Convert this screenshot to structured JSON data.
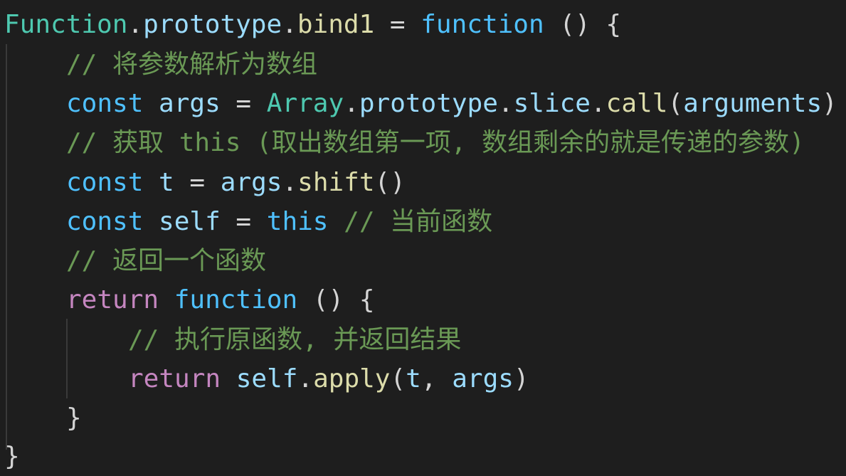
{
  "code": {
    "line1": {
      "obj": "Function",
      "dot1": ".",
      "prop1": "prototype",
      "dot2": ".",
      "prop2": "bind1",
      "eq": " = ",
      "kw": "function",
      "rest": " () {"
    },
    "line2": {
      "comment": "// 将参数解析为数组"
    },
    "line3": {
      "kw": "const",
      "name": " args",
      "eq": " = ",
      "cls": "Array",
      "dot1": ".",
      "prop1": "prototype",
      "dot2": ".",
      "prop2": "slice",
      "dot3": ".",
      "fn": "call",
      "open": "(",
      "arg": "arguments",
      "close": ")"
    },
    "line4": {
      "comment": "// 获取 this (取出数组第一项, 数组剩余的就是传递的参数)"
    },
    "line5": {
      "kw": "const",
      "name": " t",
      "eq": " = ",
      "obj": "args",
      "dot": ".",
      "fn": "shift",
      "parens": "()"
    },
    "line6": {
      "kw": "const",
      "name": " self",
      "eq": " = ",
      "this": "this",
      "comment": " // 当前函数"
    },
    "line7": {
      "comment": "// 返回一个函数"
    },
    "line8": {
      "ret": "return",
      "kw": " function",
      "rest": " () {"
    },
    "line9": {
      "comment": "// 执行原函数, 并返回结果"
    },
    "line10": {
      "ret": "return",
      "obj": " self",
      "dot": ".",
      "fn": "apply",
      "open": "(",
      "a1": "t",
      "comma": ", ",
      "a2": "args",
      "close": ")"
    },
    "line11": {
      "brace": "}"
    },
    "line12": {
      "brace": "}"
    }
  }
}
